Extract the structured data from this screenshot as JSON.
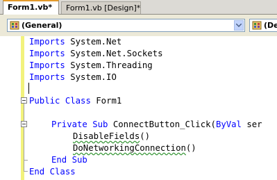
{
  "tabs": [
    {
      "label": "Form1.vb*"
    },
    {
      "label": "Form1.vb [Design]*"
    }
  ],
  "dropdowns": {
    "left_value": "(General)",
    "right_value": "(Dec"
  },
  "code": {
    "l1": {
      "kw": "Imports",
      "rest": " System.Net"
    },
    "l2": {
      "kw": "Imports",
      "rest": " System.Net.Sockets"
    },
    "l3": {
      "kw": "Imports",
      "rest": " System.Threading"
    },
    "l4": {
      "kw": "Imports",
      "rest": " System.IO"
    },
    "l6": {
      "kw1": "Public",
      "kw2": "Class",
      "rest": " Form1"
    },
    "l8": {
      "kw1": "Private",
      "kw2": "Sub",
      "name": " ConnectButton_Click(",
      "kw3": "ByVal",
      "rest": " ser"
    },
    "l9": {
      "call": "DisableFields",
      "rest": "()"
    },
    "l10": {
      "call": "DoNetworkingConnection",
      "rest": "()"
    },
    "l11": {
      "kw1": "End",
      "kw2": "Sub"
    },
    "l12": {
      "kw1": "End",
      "kw2": "Class"
    }
  },
  "colors": {
    "keyword": "#0000ff",
    "change_bar": "#f2f27c",
    "active_tab_accent": "#e39a2b"
  }
}
